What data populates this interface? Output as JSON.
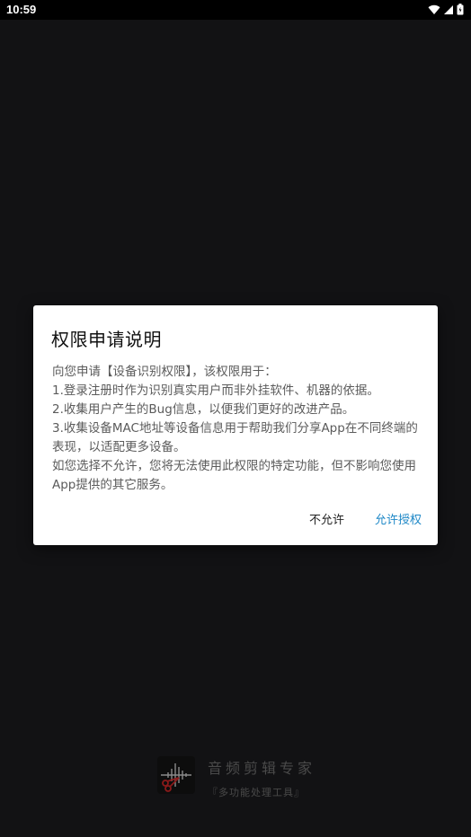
{
  "status_bar": {
    "time": "10:59",
    "icons": [
      "wifi-icon",
      "signal-icon",
      "battery-icon"
    ]
  },
  "dialog": {
    "title": "权限申请说明",
    "lines": [
      "向您申请【设备识别权限】，该权限用于：",
      "1.登录注册时作为识别真实用户而非外挂软件、机器的依据。",
      "2.收集用户产生的Bug信息，以便我们更好的改进产品。",
      "3.收集设备MAC地址等设备信息用于帮助我们分享App在不同终端的表现，以适配更多设备。",
      "如您选择不允许，您将无法使用此权限的特定功能，但不影响您使用App提供的其它服务。"
    ],
    "deny_label": "不允许",
    "allow_label": "允许授权"
  },
  "brand": {
    "name": "音频剪辑专家",
    "tagline": "『多功能处理工具』"
  },
  "colors": {
    "background": "#121214",
    "dialog_bg": "#ffffff",
    "accent": "#1e88c7"
  }
}
